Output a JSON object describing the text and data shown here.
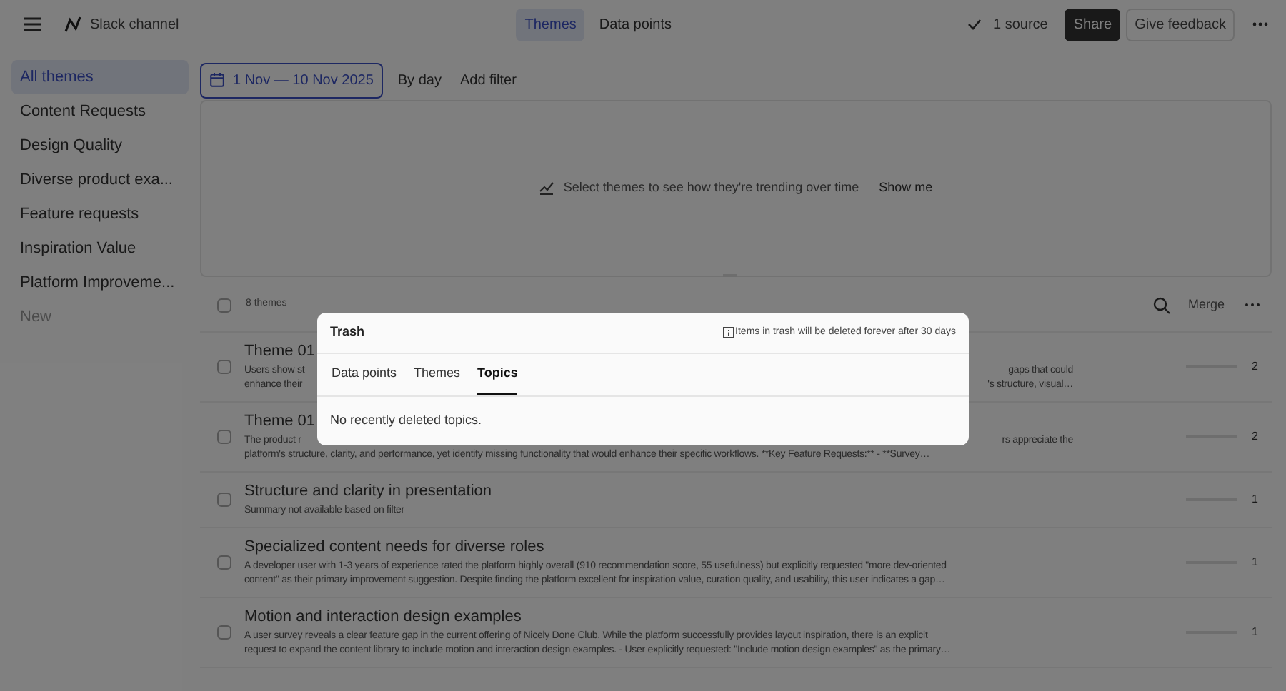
{
  "topbar": {
    "title": "Slack channel",
    "view_tabs": [
      {
        "label": "Themes",
        "selected": true
      },
      {
        "label": "Data points",
        "selected": false
      }
    ],
    "source": "1 source",
    "share": "Share",
    "feedback": "Give feedback"
  },
  "sidebar": {
    "items": [
      {
        "label": "All themes",
        "kind": "theme",
        "selected": true
      },
      {
        "label": "Content Requests",
        "kind": "theme",
        "selected": false
      },
      {
        "label": "Design Quality",
        "kind": "theme",
        "selected": false
      },
      {
        "label": "Diverse product exa...",
        "kind": "theme",
        "selected": false
      },
      {
        "label": "Feature requests",
        "kind": "theme",
        "selected": false
      },
      {
        "label": "Inspiration Value",
        "kind": "theme",
        "selected": false
      },
      {
        "label": "Platform Improveme...",
        "kind": "theme",
        "selected": false
      },
      {
        "label": "New",
        "kind": "action",
        "selected": false
      }
    ]
  },
  "toolbar": {
    "date_range": "1 Nov — 10 Nov 2025",
    "group_by": "By day",
    "filter": "Add filter"
  },
  "trend_panel": {
    "message": "Select themes to see how they're trending over time",
    "action": "Show me"
  },
  "themes": {
    "count": "8 themes",
    "all_checked": false,
    "merge": "Merge",
    "rows": [
      {
        "title": "Theme 01",
        "checked": false,
        "summary_lines": [
          [
            "Users show st",
            "gaps that could"
          ],
          [
            "enhance their",
            "'s structure, visual…"
          ]
        ],
        "count": "2"
      },
      {
        "title": "Theme 01",
        "checked": false,
        "summary_lines": [
          [
            "The product r",
            "rs appreciate the"
          ],
          [
            "platform's structure, clarity, and performance, yet identify missing functionality that would enhance their specific workflows. **Key Feature Requests:** - **Survey…"
          ]
        ],
        "count": "2"
      },
      {
        "title": "Structure and clarity in presentation",
        "checked": false,
        "summary_lines": [
          [
            "Summary not available based on filter"
          ]
        ],
        "count": "1"
      },
      {
        "title": "Specialized content needs for diverse roles",
        "checked": false,
        "summary_lines": [
          [
            "A developer user with 1-3 years of experience rated the platform highly overall (910 recommendation score, 55 usefulness) but explicitly requested \"more dev-oriented"
          ],
          [
            "content\" as their primary improvement suggestion. Despite finding the platform excellent for inspiration value, curation quality, and usability, this user indicates a gap…"
          ]
        ],
        "count": "1"
      },
      {
        "title": "Motion and interaction design examples",
        "checked": false,
        "summary_lines": [
          [
            "A user survey reveals a clear feature gap in the current offering of Nicely Done Club. While the platform successfully provides layout inspiration, there is an explicit"
          ],
          [
            "request to expand the content library to include motion and interaction design examples. - User explicitly requested: \"Include motion design examples\" as the primary…"
          ]
        ],
        "count": "1"
      }
    ]
  },
  "trash_dialog": {
    "title": "Trash",
    "notice": "Items in trash will be deleted forever after 30 days",
    "tabs": [
      {
        "label": "Data points",
        "selected": false
      },
      {
        "label": "Themes",
        "selected": false
      },
      {
        "label": "Topics",
        "selected": true
      }
    ],
    "empty_message": "No recently deleted topics."
  }
}
